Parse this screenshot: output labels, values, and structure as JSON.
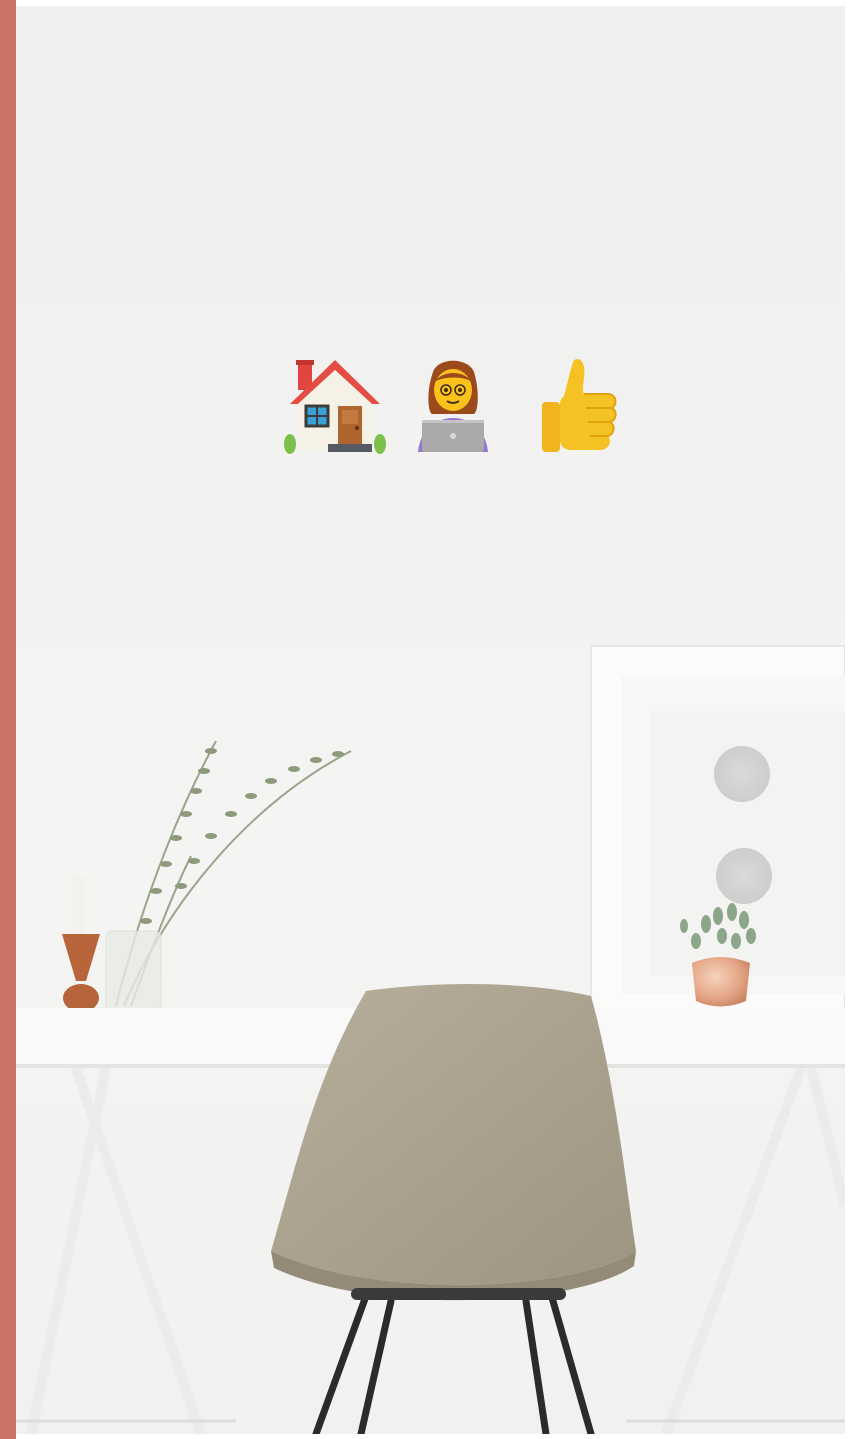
{
  "colors": {
    "accent_bar": "#c97367",
    "wall": "#efefed",
    "desk": "#f8f8f8",
    "chair": "#aea693",
    "legs": "#2b2b2b",
    "frame": "#fafaf9",
    "planter": "#e9ae8d",
    "candle_holder": "#b9653c"
  },
  "emojis": [
    {
      "name": "house-icon",
      "char": "🏠"
    },
    {
      "name": "woman-technologist-icon",
      "char": "👩‍💻"
    },
    {
      "name": "thumbs-up-icon",
      "char": "👍"
    }
  ],
  "scene": {
    "objects": [
      "wall",
      "desk",
      "chair",
      "framed-art",
      "succulent-planter",
      "eucalyptus-vase",
      "candle-holder"
    ]
  }
}
